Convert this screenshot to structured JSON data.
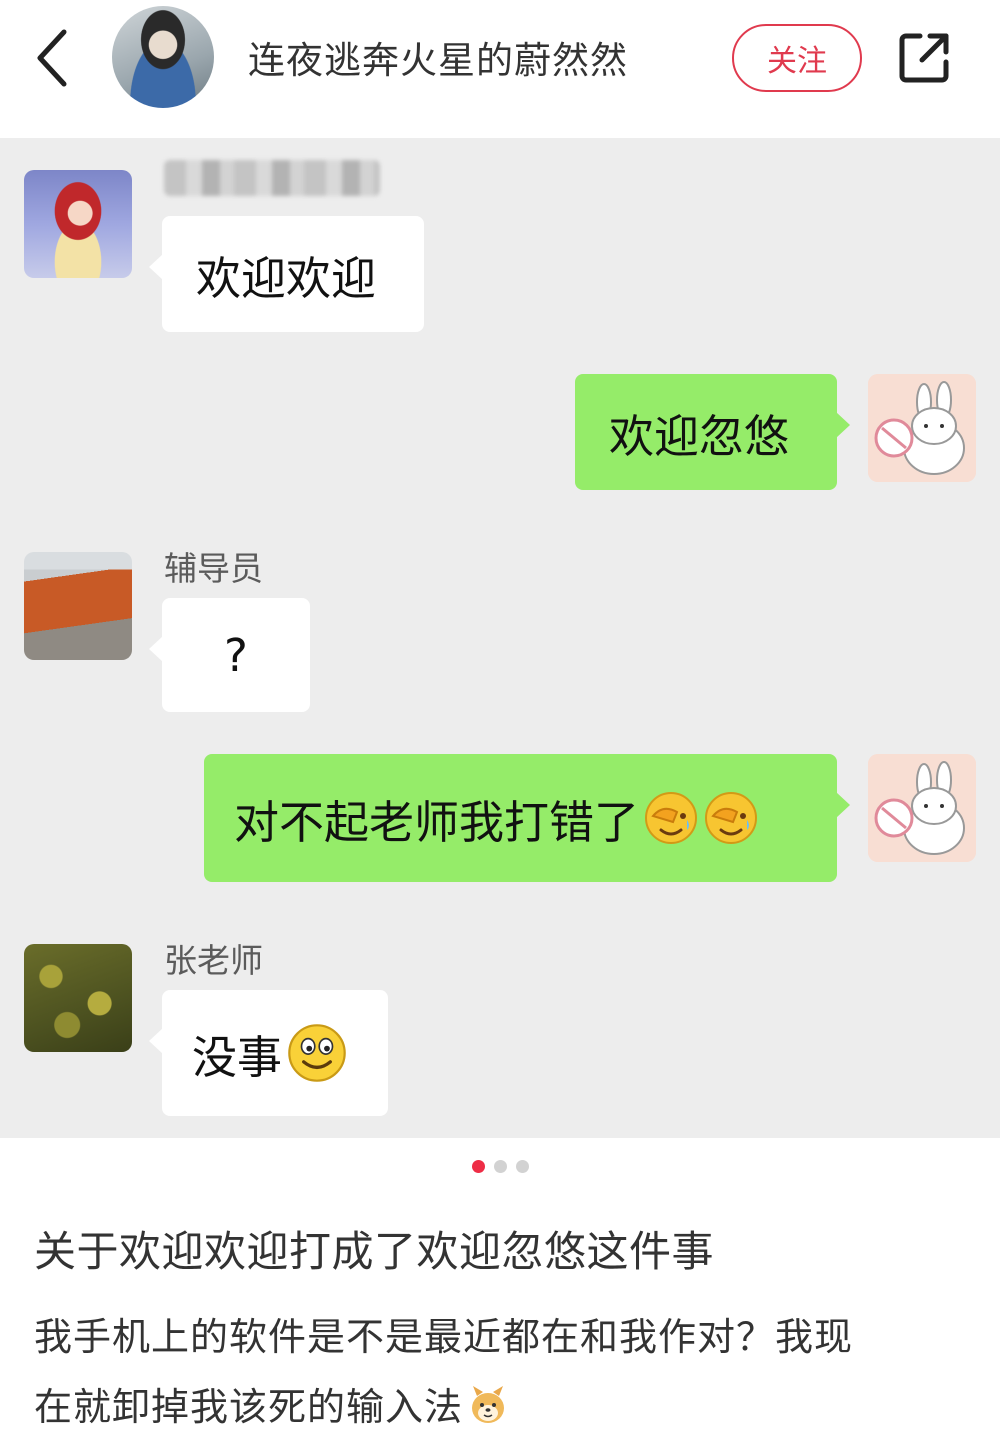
{
  "header": {
    "author_name": "连夜逃奔火星的蔚然然",
    "follow_label": "关注"
  },
  "chat": {
    "messages": [
      {
        "side": "left",
        "sender": "",
        "text": "欢迎欢迎"
      },
      {
        "side": "right",
        "text": "欢迎忽悠"
      },
      {
        "side": "left",
        "sender": "辅导员",
        "text": "?"
      },
      {
        "side": "right",
        "text": "对不起老师我打错了"
      },
      {
        "side": "left",
        "sender": "张老师",
        "text": "没事"
      }
    ]
  },
  "pagination": {
    "total": 3,
    "current": 1
  },
  "post": {
    "title": "关于欢迎欢迎打成了欢迎忽悠这件事",
    "body_line1": "我手机上的软件是不是最近都在和我作对？我现",
    "body_line2": "在就卸掉我该死的输入法"
  },
  "colors": {
    "accent": "#e03a4e",
    "wechat_green": "#95ec69",
    "chat_bg": "#ededed"
  },
  "icons": [
    "back-icon",
    "share-icon",
    "facepalm-emoji",
    "smile-emoji",
    "shiba-sticker-icon"
  ]
}
